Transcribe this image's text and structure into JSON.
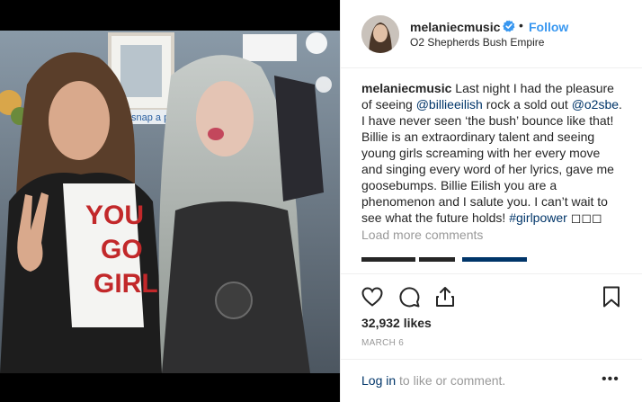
{
  "post": {
    "username": "melaniecmusic",
    "follow_label": "Follow",
    "dot": "•",
    "location": "O2 Shepherds Bush Empire",
    "caption": {
      "part1": " Last night I had the pleasure of seeing ",
      "mention1": "@billieeilish",
      "part2": " rock a sold out ",
      "mention2": "@o2sbe",
      "part3": ". I have never seen ‘the bush’ bounce like that! Billie is an extraordinary talent and seeing young girls screaming with her every move and singing every word of her lyrics, gave me goosebumps. Billie Eilish you are a phenomenon and I salute you. I can’t wait to see what the future holds! ",
      "hashtag": "#girlpower",
      "emoji": " ◻◻◻"
    },
    "load_more": "Load more comments",
    "likes": "32,932 likes",
    "date": "MARCH 6",
    "login_link": "Log in",
    "login_text": " to like or comment.",
    "more": "•••"
  },
  "photo": {
    "shirt_text_line1": "YOU",
    "shirt_text_line2": "GO",
    "shirt_text_line3": "GIRL",
    "sign_text": "snap a pic"
  },
  "icons": [
    "heart-icon",
    "comment-icon",
    "share-icon",
    "bookmark-icon",
    "verified-badge-icon",
    "more-options-icon"
  ],
  "colors": {
    "accent": "#3897f0",
    "text": "#262626",
    "muted": "#999999",
    "link": "#003569",
    "border": "#efefef"
  }
}
